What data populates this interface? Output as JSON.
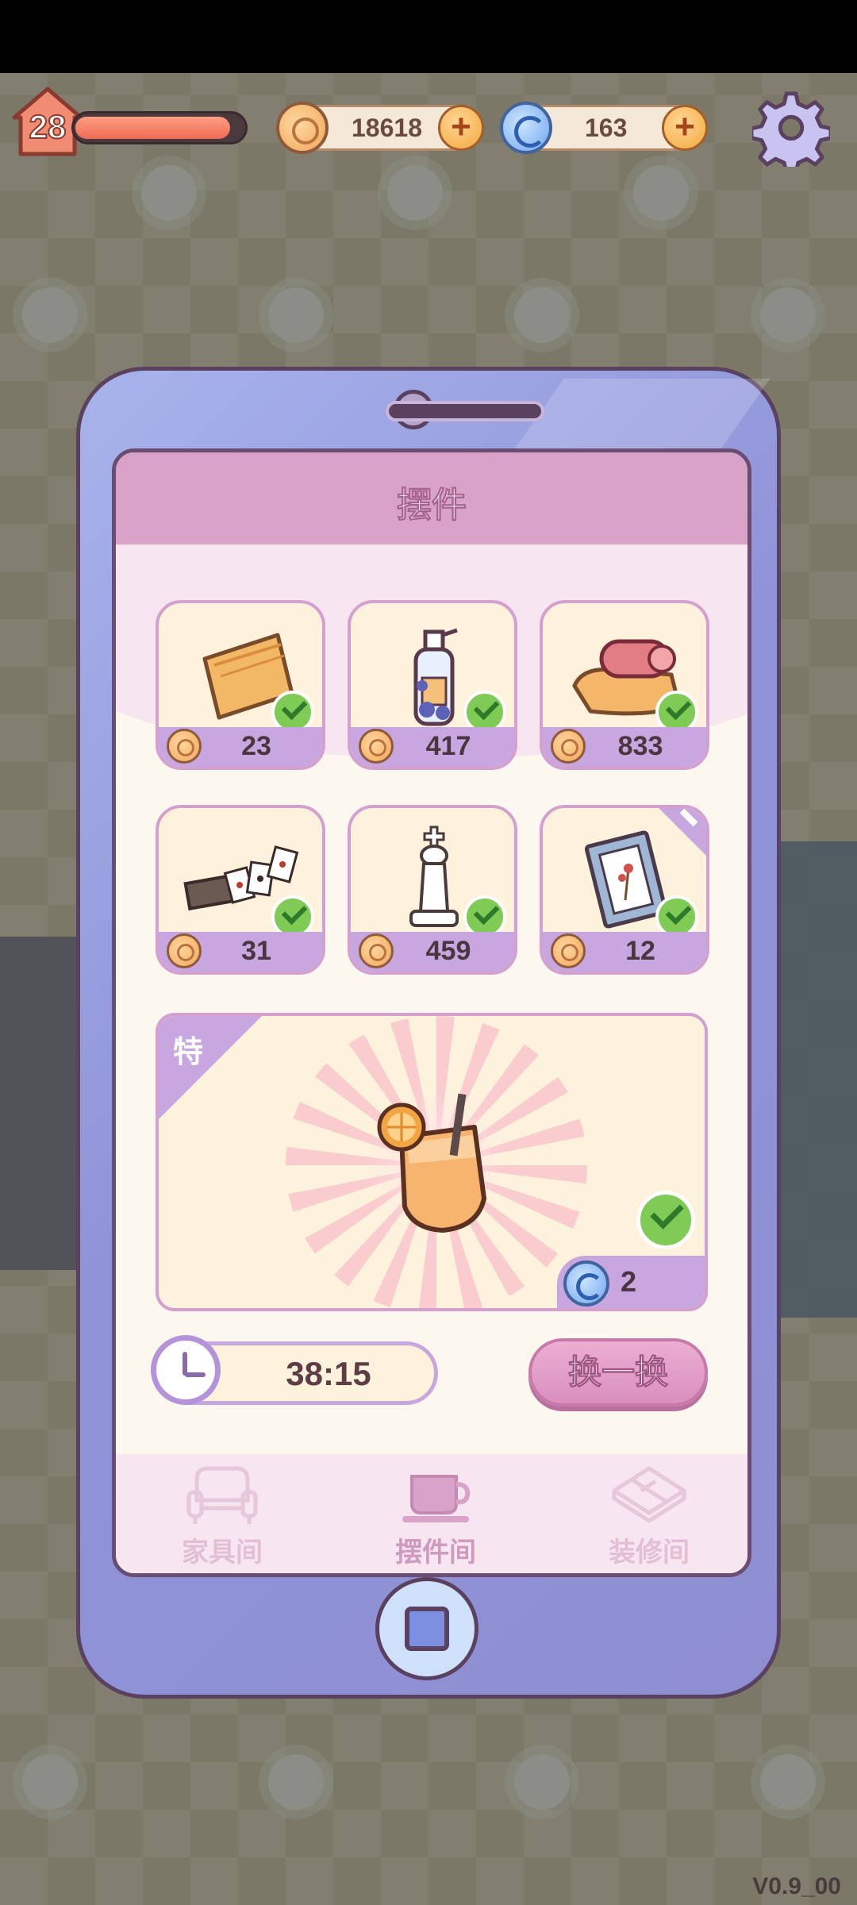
{
  "hud": {
    "level": "28",
    "xp_progress": 0.92,
    "coins": "18618",
    "gems": "163"
  },
  "panel": {
    "title": "摆件"
  },
  "items": [
    {
      "name": "pillow",
      "price": "23",
      "owned": true,
      "new": false
    },
    {
      "name": "lotion-bottle",
      "price": "417",
      "owned": true,
      "new": false
    },
    {
      "name": "rolled-towel",
      "price": "833",
      "owned": true,
      "new": false
    },
    {
      "name": "playing-cards",
      "price": "31",
      "owned": true,
      "new": false
    },
    {
      "name": "chess-king",
      "price": "459",
      "owned": true,
      "new": false
    },
    {
      "name": "picture-frame",
      "price": "12",
      "owned": true,
      "new": true
    }
  ],
  "special": {
    "label": "特",
    "item": "orange-juice",
    "price": "2",
    "owned": true
  },
  "timer": "38:15",
  "swap_button": "换一换",
  "tabs": [
    {
      "label": "家具间",
      "icon": "armchair-icon",
      "active": false
    },
    {
      "label": "摆件间",
      "icon": "coffee-cup-icon",
      "active": true
    },
    {
      "label": "装修间",
      "icon": "floor-tile-icon",
      "active": false
    }
  ],
  "version": "V0.9_00"
}
